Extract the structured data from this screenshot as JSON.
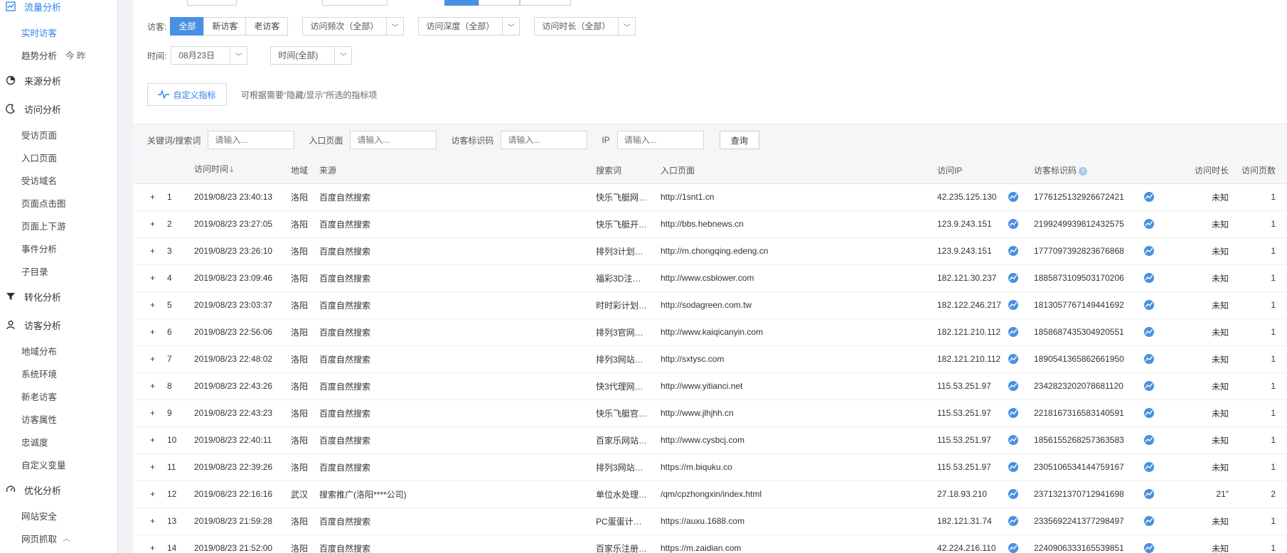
{
  "sidebar": {
    "traffic_group": "流量分析",
    "traffic_items": [
      {
        "label": "实时访客",
        "active": true
      },
      {
        "label": "趋势分析",
        "extra": "今  昨"
      }
    ],
    "source_group": "来源分析",
    "visit_group": "访问分析",
    "visit_items": [
      "受访页面",
      "入口页面",
      "受访域名",
      "页面点击图",
      "页面上下游",
      "事件分析",
      "子目录"
    ],
    "convert_group": "转化分析",
    "visitor_group": "访客分析",
    "visitor_items": [
      "地域分布",
      "系统环境",
      "新老访客",
      "访客属性",
      "忠诚度",
      "自定义变量"
    ],
    "optimize_group": "优化分析",
    "optimize_items": [
      "网站安全",
      "网页抓取"
    ]
  },
  "filters": {
    "visitor_label": "访客:",
    "visitor_options": [
      "全部",
      "新访客",
      "老访客"
    ],
    "freq_select": "访问频次（全部）",
    "depth_select": "访问深度（全部）",
    "duration_select": "访问时长（全部）",
    "time_label": "时间:",
    "date_select": "08月23日",
    "time_select": "时间(全部)",
    "custom_metric_button": "自定义指标",
    "custom_hint": "可根据需要“隐藏/显示”所选的指标项"
  },
  "search": {
    "keyword_label": "关键词/搜索词",
    "keyword_placeholder": "请输入...",
    "entry_label": "入口页面",
    "entry_placeholder": "请输入...",
    "visitor_id_label": "访客标识码",
    "visitor_id_placeholder": "请输入...",
    "ip_label": "IP",
    "ip_placeholder": "请输入...",
    "query_button": "查询"
  },
  "table": {
    "headers": {
      "time": "访问时间",
      "region": "地域",
      "source": "来源",
      "keyword": "搜索词",
      "entry": "入口页面",
      "ip": "访问IP",
      "visitor_id": "访客标识码",
      "duration": "访问时长",
      "pages": "访问页数"
    },
    "rows": [
      {
        "n": "1",
        "time": "2019/08/23 23:40:13",
        "region": "洛阳",
        "source": "百度自然搜索",
        "keyword": "快乐飞艇网…",
        "entry": "http://1snt1.cn",
        "ip": "42.235.125.130",
        "vid": "1776125132926672421",
        "duration": "未知",
        "pages": "1"
      },
      {
        "n": "2",
        "time": "2019/08/23 23:27:05",
        "region": "洛阳",
        "source": "百度自然搜索",
        "keyword": "快乐飞艇开…",
        "entry": "http://bbs.hebnews.cn",
        "ip": "123.9.243.151",
        "vid": "2199249939812432575",
        "duration": "未知",
        "pages": "1"
      },
      {
        "n": "3",
        "time": "2019/08/23 23:26:10",
        "region": "洛阳",
        "source": "百度自然搜索",
        "keyword": "排列3计划…",
        "entry": "http://m.chongqing.edeng.cn",
        "ip": "123.9.243.151",
        "vid": "1777097392823676868",
        "duration": "未知",
        "pages": "1"
      },
      {
        "n": "4",
        "time": "2019/08/23 23:09:46",
        "region": "洛阳",
        "source": "百度自然搜索",
        "keyword": "福彩3D注…",
        "entry": "http://www.csblower.com",
        "ip": "182.121.30.237",
        "vid": "1885873109503170206",
        "duration": "未知",
        "pages": "1"
      },
      {
        "n": "5",
        "time": "2019/08/23 23:03:37",
        "region": "洛阳",
        "source": "百度自然搜索",
        "keyword": "时时彩计划…",
        "entry": "http://sodagreen.com.tw",
        "ip": "182.122.246.217",
        "vid": "1813057767149441692",
        "duration": "未知",
        "pages": "1"
      },
      {
        "n": "6",
        "time": "2019/08/23 22:56:06",
        "region": "洛阳",
        "source": "百度自然搜索",
        "keyword": "排列3官网…",
        "entry": "http://www.kaiqicanyin.com",
        "ip": "182.121.210.112",
        "vid": "1858687435304920551",
        "duration": "未知",
        "pages": "1"
      },
      {
        "n": "7",
        "time": "2019/08/23 22:48:02",
        "region": "洛阳",
        "source": "百度自然搜索",
        "keyword": "排列3网站…",
        "entry": "http://sxtysc.com",
        "ip": "182.121.210.112",
        "vid": "1890541365862661950",
        "duration": "未知",
        "pages": "1"
      },
      {
        "n": "8",
        "time": "2019/08/23 22:43:26",
        "region": "洛阳",
        "source": "百度自然搜索",
        "keyword": "快3代理网…",
        "entry": "http://www.yitianci.net",
        "ip": "115.53.251.97",
        "vid": "2342823202078681120",
        "duration": "未知",
        "pages": "1"
      },
      {
        "n": "9",
        "time": "2019/08/23 22:43:23",
        "region": "洛阳",
        "source": "百度自然搜索",
        "keyword": "快乐飞艇官…",
        "entry": "http://www.jlhjhh.cn",
        "ip": "115.53.251.97",
        "vid": "2218167316583140591",
        "duration": "未知",
        "pages": "1"
      },
      {
        "n": "10",
        "time": "2019/08/23 22:40:11",
        "region": "洛阳",
        "source": "百度自然搜索",
        "keyword": "百家乐网站…",
        "entry": "http://www.cysbcj.com",
        "ip": "115.53.251.97",
        "vid": "1856155268257363583",
        "duration": "未知",
        "pages": "1"
      },
      {
        "n": "11",
        "time": "2019/08/23 22:39:26",
        "region": "洛阳",
        "source": "百度自然搜索",
        "keyword": "排列3网站…",
        "entry": "https://m.biquku.co",
        "ip": "115.53.251.97",
        "vid": "2305106534144759167",
        "duration": "未知",
        "pages": "1"
      },
      {
        "n": "12",
        "time": "2019/08/23 22:16:16",
        "region": "武汉",
        "source": "搜索推广(洛阳****公司)",
        "keyword": "单位水处理…",
        "entry": "/qm/cpzhongxin/index.html",
        "ip": "27.18.93.210",
        "vid": "2371321370712941698",
        "duration": "21\"",
        "pages": "2"
      },
      {
        "n": "13",
        "time": "2019/08/23 21:59:28",
        "region": "洛阳",
        "source": "百度自然搜索",
        "keyword": "PC蛋蛋计…",
        "entry": "https://auxu.1688.com",
        "ip": "182.121.31.74",
        "vid": "2335692241377298497",
        "duration": "未知",
        "pages": "1"
      },
      {
        "n": "14",
        "time": "2019/08/23 21:52:00",
        "region": "洛阳",
        "source": "百度自然搜索",
        "keyword": "百家乐注册…",
        "entry": "https://m.zaidian.com",
        "ip": "42.224.216.110",
        "vid": "2240906333165539851",
        "duration": "未知",
        "pages": "1"
      }
    ]
  },
  "colors": {
    "accent": "#4a90e2",
    "link": "#2f6fcf"
  }
}
